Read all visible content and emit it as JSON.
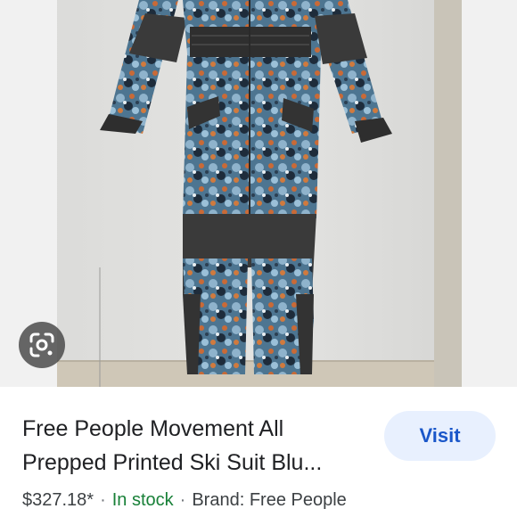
{
  "product": {
    "title_line1": "Free People Movement All",
    "title_line2": "Prepped Printed Ski Suit Blu...",
    "price": "$327.18*",
    "stock": "In stock",
    "brand": "Brand: Free People",
    "separator": "·"
  },
  "actions": {
    "visit_label": "Visit",
    "lens_icon": "google-lens-icon"
  },
  "colors": {
    "visit_bg": "#e8f0fe",
    "visit_text": "#1a57c9",
    "stock_green": "#188038"
  }
}
